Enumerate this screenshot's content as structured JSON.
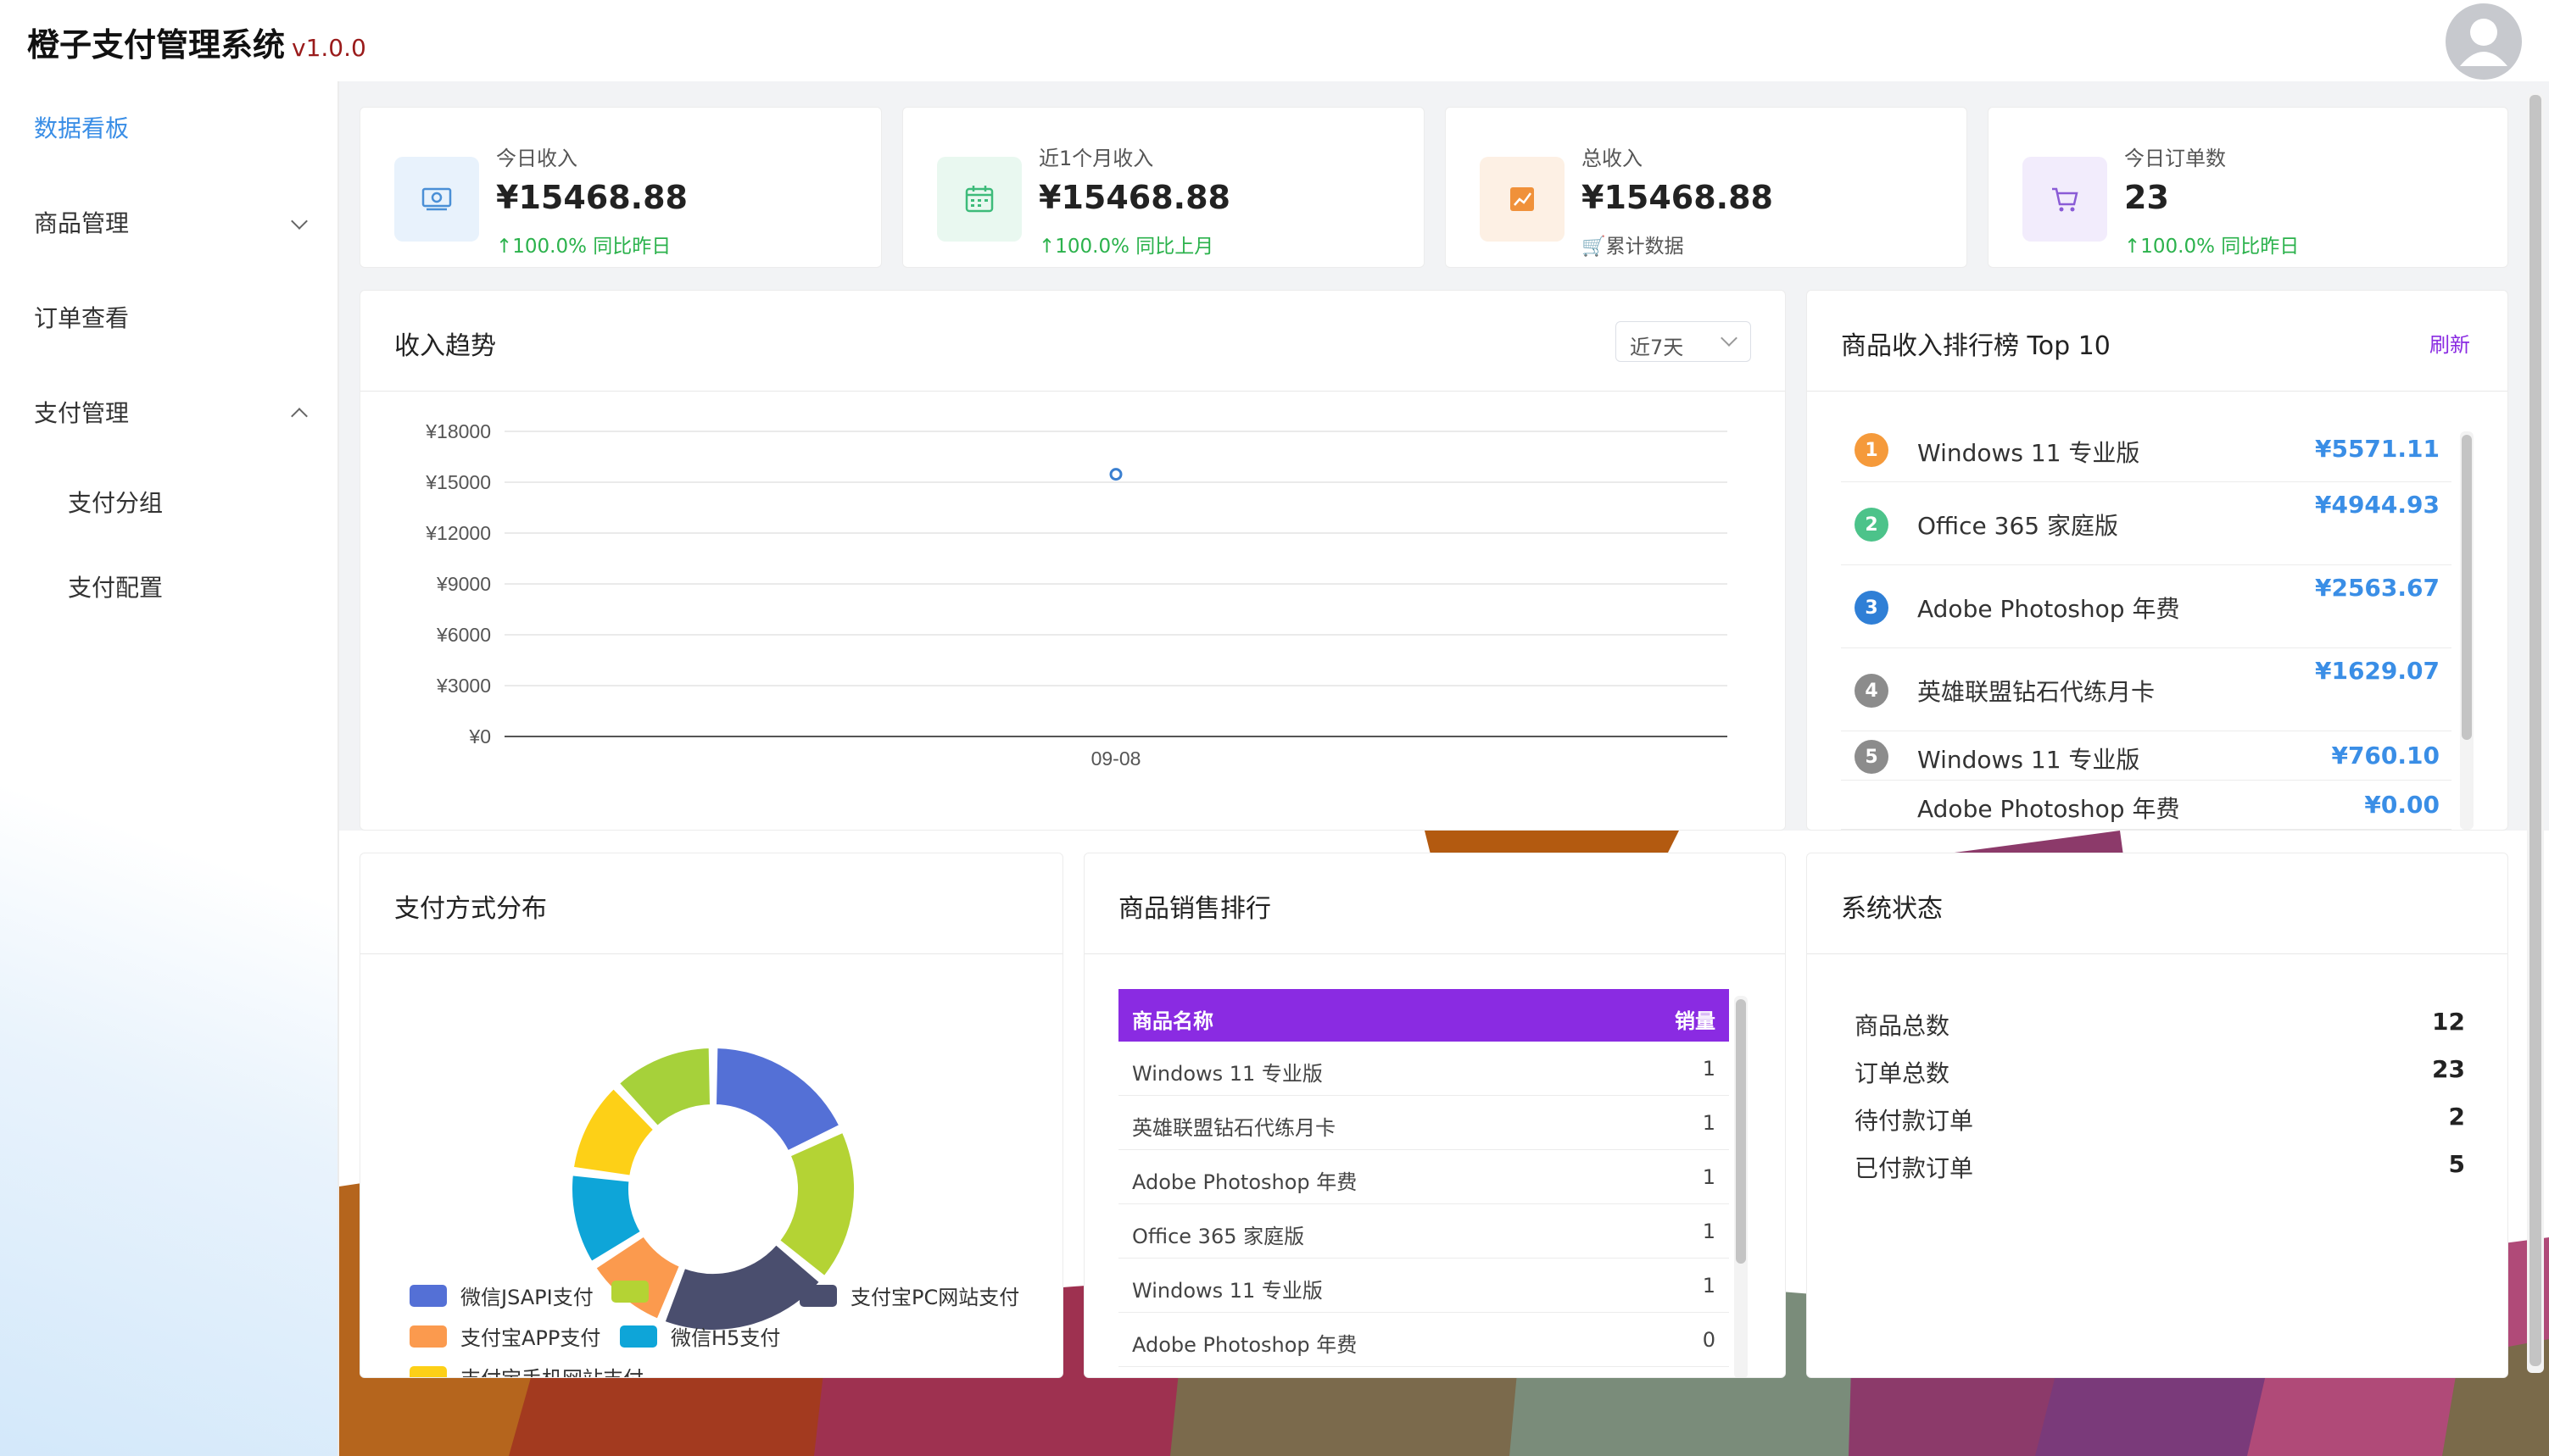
{
  "header": {
    "title": "橙子支付管理系统",
    "version": "v1.0.0",
    "avatar_icon": "user-avatar-icon"
  },
  "sidebar": {
    "items": [
      {
        "label": "数据看板",
        "active": true
      },
      {
        "label": "商品管理",
        "chevron": "down"
      },
      {
        "label": "订单查看"
      },
      {
        "label": "支付管理",
        "chevron": "up"
      },
      {
        "label": "支付分组",
        "sub": true
      },
      {
        "label": "支付配置",
        "sub": true
      }
    ]
  },
  "stats": [
    {
      "label": "今日收入",
      "value": "¥15468.88",
      "sub": "↑100.0% 同比昨日",
      "icon": "money-icon",
      "color": "#4a8fd6"
    },
    {
      "label": "近1个月收入",
      "value": "¥15468.88",
      "sub": "↑100.0% 同比上月",
      "icon": "calendar-icon",
      "color": "#3dbb7a"
    },
    {
      "label": "总收入",
      "value": "¥15468.88",
      "sub": "累计数据",
      "icon": "trend-chart-icon",
      "color": "#f0913a"
    },
    {
      "label": "今日订单数",
      "value": "23",
      "sub": "↑100.0% 同比昨日",
      "icon": "cart-icon",
      "color": "#8a5bd6"
    }
  ],
  "trend": {
    "title": "收入趋势",
    "range_select": "近7天"
  },
  "chart_data": [
    {
      "type": "line",
      "x": [
        "09-08"
      ],
      "series": [
        {
          "values": [
            15468.88
          ]
        }
      ],
      "ylim": [
        0,
        18000
      ],
      "yticks": [
        "¥0",
        "¥3000",
        "¥6000",
        "¥9000",
        "¥12000",
        "¥15000",
        "¥18000"
      ],
      "grid": true
    },
    {
      "type": "pie",
      "legend": [
        "微信JSAPI支付",
        "",
        "支付宝PC网站支付",
        "支付宝APP支付",
        "微信H5支付",
        "支付宝手机网站支付"
      ],
      "slices": [
        {
          "color": "#5470d6",
          "value": 18
        },
        {
          "color": "#b4d334",
          "value": 18
        },
        {
          "color": "#4a4e6e",
          "value": 20
        },
        {
          "color": "#fb9a4e",
          "value": 10
        },
        {
          "color": "#0ea5d8",
          "value": 11
        },
        {
          "color": "#fdd017",
          "value": 11
        },
        {
          "color": "#a6d13a",
          "value": 12
        }
      ]
    }
  ],
  "ranking": {
    "title": "商品收入排行榜 Top 10",
    "refresh": "刷新",
    "rows": [
      {
        "rank": "1",
        "name": "Windows 11 专业版",
        "value": "¥5571.11",
        "color": "#f59a3b"
      },
      {
        "rank": "2",
        "name": "Office 365 家庭版",
        "value": "¥4944.93",
        "color": "#4cc38a"
      },
      {
        "rank": "3",
        "name": "Adobe Photoshop 年费",
        "value": "¥2563.67",
        "color": "#2f7fd6"
      },
      {
        "rank": "4",
        "name": "英雄联盟钻石代练月卡",
        "value": "¥1629.07",
        "color": "#8c8c8c"
      },
      {
        "rank": "5",
        "name": "Windows 11 专业版",
        "value": "¥760.10",
        "color": "#8c8c8c"
      },
      {
        "rank": "",
        "name": "Adobe Photoshop 年费",
        "value": "¥0.00",
        "color": ""
      }
    ]
  },
  "pay_dist": {
    "title": "支付方式分布"
  },
  "sales": {
    "title": "商品销售排行",
    "col_name": "商品名称",
    "col_qty": "销量",
    "rows": [
      {
        "name": "Windows 11 专业版",
        "qty": "1"
      },
      {
        "name": "英雄联盟钻石代练月卡",
        "qty": "1"
      },
      {
        "name": "Adobe Photoshop 年费",
        "qty": "1"
      },
      {
        "name": "Office 365 家庭版",
        "qty": "1"
      },
      {
        "name": "Windows 11 专业版",
        "qty": "1"
      },
      {
        "name": "Adobe Photoshop 年费",
        "qty": "0"
      }
    ]
  },
  "system": {
    "title": "系统状态",
    "rows": [
      {
        "label": "商品总数",
        "value": "12"
      },
      {
        "label": "订单总数",
        "value": "23"
      },
      {
        "label": "待付款订单",
        "value": "2"
      },
      {
        "label": "已付款订单",
        "value": "5"
      }
    ]
  }
}
